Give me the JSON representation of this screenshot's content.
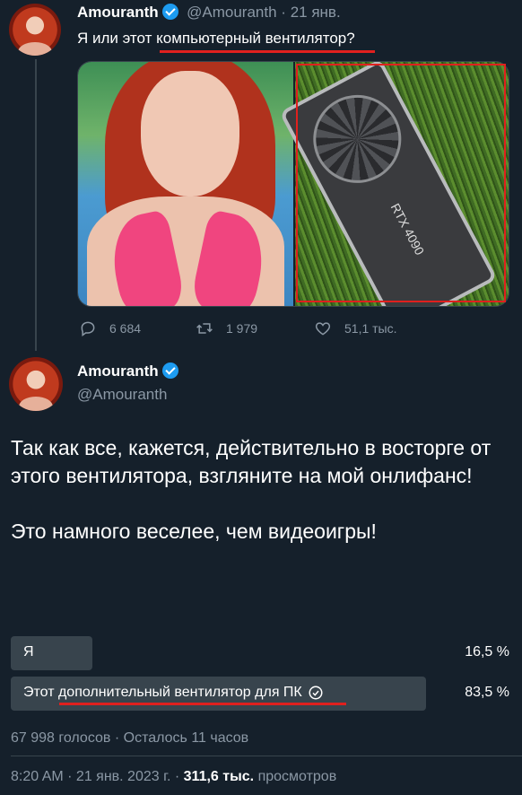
{
  "tweet1": {
    "name": "Amouranth",
    "handle": "@Amouranth",
    "separator": "·",
    "date": "21 янв.",
    "text": "Я или этот компьютерный вентилятор?",
    "media_right_label": "RTX 4090",
    "replies": "6 684",
    "retweets": "1 979",
    "likes": "51,1 тыс."
  },
  "tweet2": {
    "name": "Amouranth",
    "handle": "@Amouranth",
    "paragraph1": "Так как все, кажется, действительно в восторге от этого вентилятора, взгляните на мой онлифанс!",
    "paragraph2": "Это намного веселее, чем видеоигры!",
    "poll": {
      "options": [
        {
          "label": "Я",
          "percent_text": "16,5 %",
          "percent": 16.5,
          "selected": false
        },
        {
          "label": "Этот дополнительный вентилятор для ПК",
          "percent_text": "83,5 %",
          "percent": 83.5,
          "selected": true
        }
      ],
      "meta": "67 998 голосов · Осталось 11 часов"
    },
    "time": "8:20 AM · 21 янв. 2023 г. ·",
    "views_count": "311,6 тыс.",
    "views_label": "просмотров"
  },
  "colors": {
    "background": "#15202b",
    "accent": "#1d9bf0",
    "highlight": "#e0201e"
  }
}
